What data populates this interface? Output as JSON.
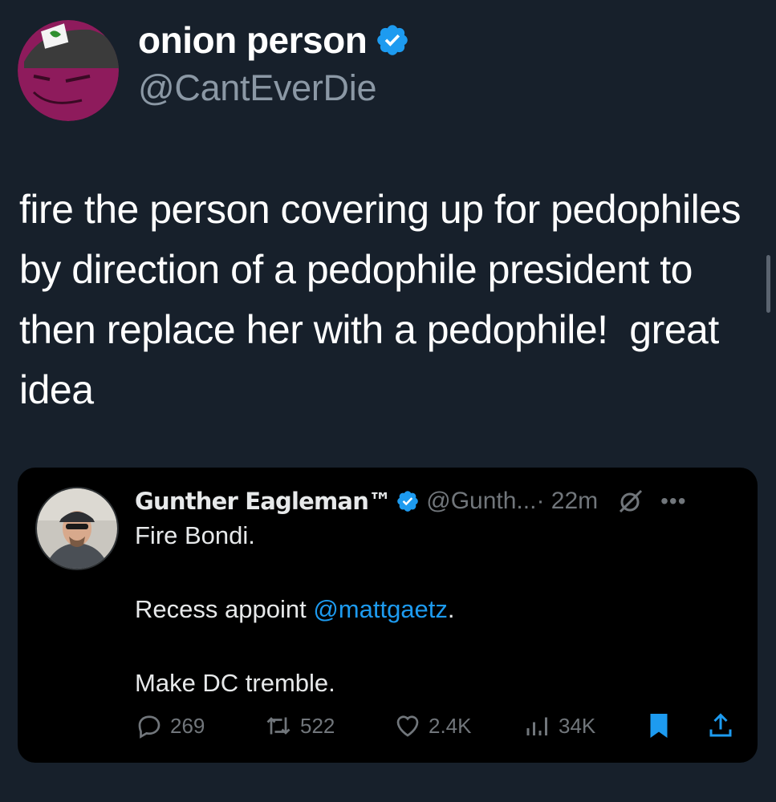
{
  "tweet": {
    "display_name": "onion person",
    "handle": "@CantEverDie",
    "text": "fire the person covering up for pedophiles by direction of a pedophile president to then replace her with a pedophile!  great idea"
  },
  "quote": {
    "display_name": "Gunther Eagleman™",
    "handle": "@Gunth...",
    "time": " · 22m",
    "more": "•••",
    "text_line1": "Fire Bondi.",
    "text_line2_prefix": "Recess appoint ",
    "text_line2_mention": "@mattgaetz",
    "text_line2_suffix": ".",
    "text_line3": "Make DC tremble.",
    "replies": "269",
    "retweets": "522",
    "likes": "2.4K",
    "views": "34K"
  },
  "colors": {
    "background": "#17202b",
    "card_background": "#000000",
    "accent": "#1d9bf0",
    "muted": "#71767b"
  },
  "icons": [
    "verified-badge-icon",
    "grok-icon",
    "more-icon",
    "reply-icon",
    "retweet-icon",
    "like-icon",
    "views-icon",
    "bookmark-icon",
    "share-icon"
  ]
}
